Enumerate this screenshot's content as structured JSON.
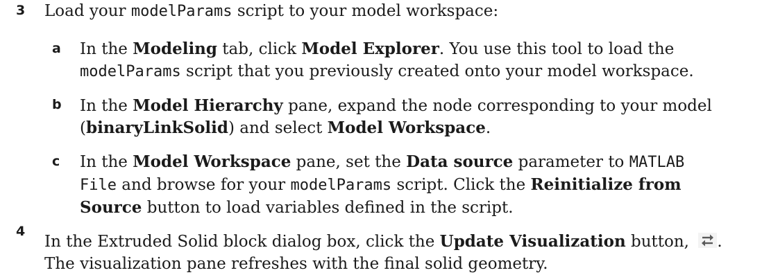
{
  "step3": {
    "number": "3",
    "line": {
      "pre": "Load your ",
      "code": "modelParams",
      "post": " script to your model workspace:"
    },
    "a": {
      "letter": "a",
      "t1": "In the ",
      "b1": "Modeling",
      "t2": " tab, click ",
      "b2": "Model Explorer",
      "t3": ". You use this tool to load the",
      "code": "modelParams",
      "t4": " script that you previously created onto your model workspace."
    },
    "b": {
      "letter": "b",
      "t1": "In the ",
      "b1": "Model Hierarchy",
      "t2": " pane, expand the node corresponding to your model",
      "t3": "(",
      "b2": "binaryLinkSolid",
      "t4": ") and select ",
      "b3": "Model Workspace",
      "t5": "."
    },
    "c": {
      "letter": "c",
      "t1": "In the ",
      "b1": "Model Workspace",
      "t2": " pane, set the ",
      "b2": "Data source",
      "t3": " parameter to ",
      "code1a": "MATLAB",
      "code1b": "File",
      "t4": " and browse for your ",
      "code2": "modelParams",
      "t5": " script. Click the ",
      "b3": "Reinitialize from",
      "b4": "Source",
      "t6": " button to load variables defined in the script."
    }
  },
  "step4": {
    "number": "4",
    "t1": "In the Extruded Solid block dialog box, click the ",
    "b1": "Update Visualization",
    "t2": " button, ",
    "t3": ".",
    "line2": "The visualization pane refreshes with the final solid geometry.",
    "icon": "update-visualization-icon"
  }
}
